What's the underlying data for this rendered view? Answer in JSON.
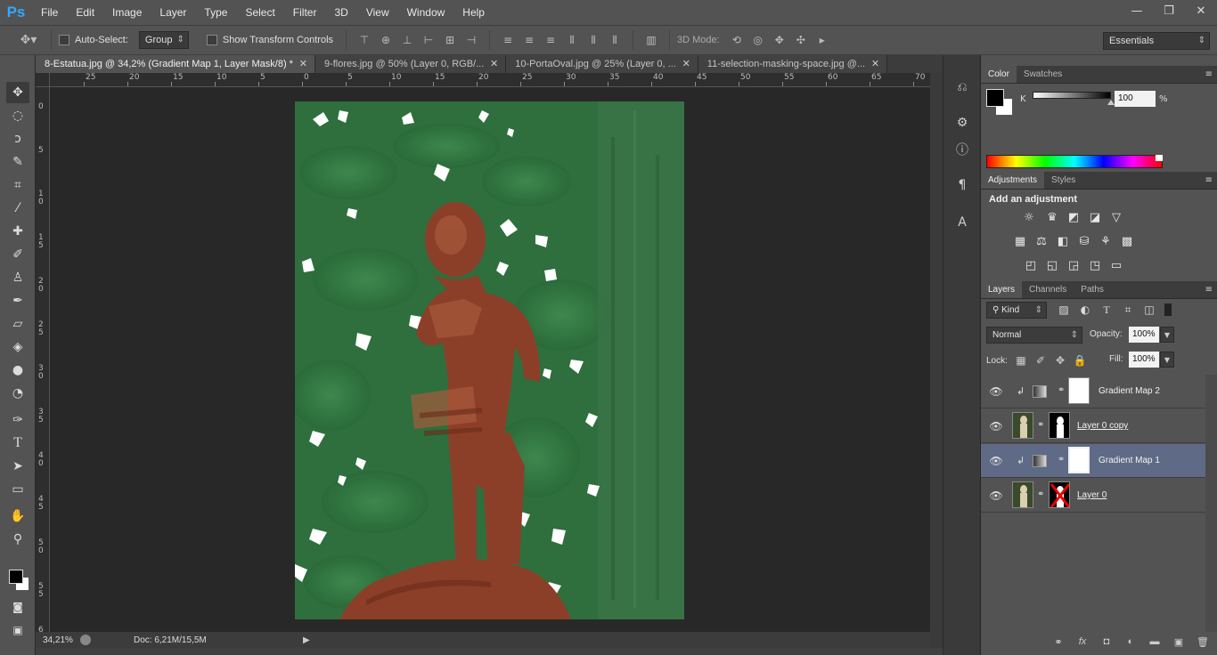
{
  "app": {
    "logo": "Ps"
  },
  "menu": [
    "File",
    "Edit",
    "Image",
    "Layer",
    "Type",
    "Select",
    "Filter",
    "3D",
    "View",
    "Window",
    "Help"
  ],
  "window_controls": {
    "minimize": "—",
    "restore": "❐",
    "close": "✕"
  },
  "options": {
    "auto_select_label": "Auto-Select:",
    "auto_select_value": "Group",
    "transform_label": "Show Transform Controls",
    "mode_3d_label": "3D Mode:",
    "workspace": "Essentials"
  },
  "tabs": [
    {
      "label": "8-Estatua.jpg @ 34,2% (Gradient Map 1, Layer Mask/8) *",
      "close": "✕"
    },
    {
      "label": "9-flores.jpg @ 50% (Layer 0, RGB/...",
      "close": "✕"
    },
    {
      "label": "10-PortaOval.jpg @ 25% (Layer 0, ...",
      "close": "✕"
    },
    {
      "label": "11-selection-masking-space.jpg @...",
      "close": "✕"
    }
  ],
  "ruler_top": [
    "25",
    "20",
    "15",
    "10",
    "5",
    "0",
    "5",
    "10",
    "15",
    "20",
    "25",
    "30",
    "35",
    "40",
    "45",
    "50",
    "55",
    "60",
    "65",
    "70"
  ],
  "ruler_left": [
    "0",
    "5",
    "1\n0",
    "1\n5",
    "2\n0",
    "2\n5",
    "3\n0",
    "3\n5",
    "4\n0",
    "4\n5",
    "5\n0",
    "5\n5",
    "6"
  ],
  "status": {
    "zoom": "34,21%",
    "doc": "Doc: 6,21M/15,5M",
    "arrow": "▶"
  },
  "panels": {
    "color_tab": "Color",
    "swatches_tab": "Swatches",
    "k_label": "K",
    "k_value": "100",
    "k_unit": "%",
    "adjustments_tab": "Adjustments",
    "styles_tab": "Styles",
    "add_adjustment": "Add an adjustment",
    "layers_tab": "Layers",
    "channels_tab": "Channels",
    "paths_tab": "Paths",
    "kind_label": "Kind",
    "blend_mode": "Normal",
    "opacity_label": "Opacity:",
    "opacity_value": "100%",
    "lock_label": "Lock:",
    "fill_label": "Fill:",
    "fill_value": "100%",
    "menu_glyph": "≡"
  },
  "layers": [
    {
      "name": "Gradient Map 2",
      "type": "adjustment"
    },
    {
      "name": "Layer 0 copy",
      "type": "image"
    },
    {
      "name": "Gradient Map 1",
      "type": "adjustment",
      "selected": true
    },
    {
      "name": "Layer 0",
      "type": "image"
    }
  ],
  "layers_footer": [
    "⚭",
    "fx",
    "◘",
    "◐",
    "▬",
    "▣",
    "🗑"
  ],
  "colors": {
    "canvas_green": "#2d6e3c",
    "statue_brown": "#8c3f28",
    "ps_blue": "#31a8ff"
  }
}
